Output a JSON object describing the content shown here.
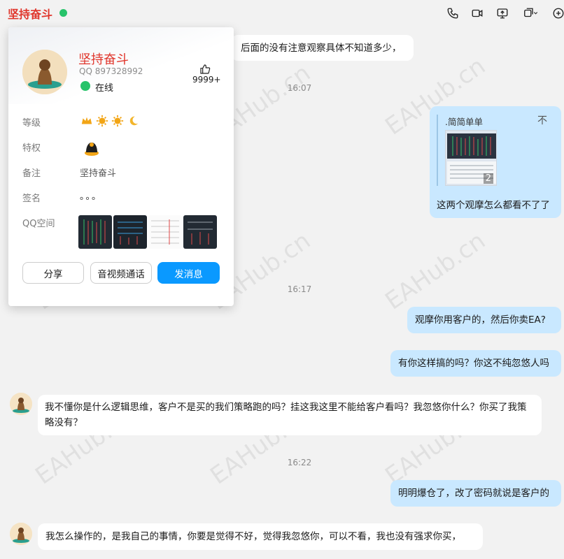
{
  "header": {
    "title": "坚持奋斗",
    "status_color": "#27c36a",
    "toolbar": [
      {
        "name": "phone-icon"
      },
      {
        "name": "video-icon"
      },
      {
        "name": "screen-share-icon"
      },
      {
        "name": "more-window-icon"
      },
      {
        "name": "add-icon"
      }
    ]
  },
  "profile_card": {
    "name": "坚持奋斗",
    "qq": "QQ 897328992",
    "status": "在线",
    "likes": "9999+",
    "rows": {
      "level_label": "等级",
      "privilege_label": "特权",
      "remark_label": "备注",
      "remark_value": "坚持奋斗",
      "signature_label": "签名",
      "signature_value": "。。。",
      "zone_label": "QQ空间"
    },
    "buttons": {
      "share": "分享",
      "call": "音视频通话",
      "message": "发消息"
    }
  },
  "messages": {
    "m1": "后面的没有注意观察具体不知道多少，",
    "t1": "16:07",
    "quote_name": ".简简单单",
    "quote_close": "不",
    "quote_count": "2",
    "m2": "这两个观摩怎么都看不了了",
    "t2": "16:17",
    "m3": "观摩你用客户的，然后你卖EA?",
    "m4": "有你这样搞的吗？你这不纯忽悠人吗",
    "m5": "我不懂你是什么逻辑思维，客户不是买的我们策略跑的吗？挂这我这里不能给客户看吗？我忽悠你什么？你买了我策略没有？",
    "t3": "16:22",
    "m6": "明明爆仓了，改了密码就说是客户的",
    "m7": "我怎么操作的，是我自己的事情，你要是觉得不好，觉得我忽悠你，可以不看，我也没有强求你买，"
  },
  "watermark": "EAHub.cn",
  "colors": {
    "accent": "#0a99ff",
    "name_red": "#e0352b",
    "bubble_self": "#c9e8ff"
  }
}
